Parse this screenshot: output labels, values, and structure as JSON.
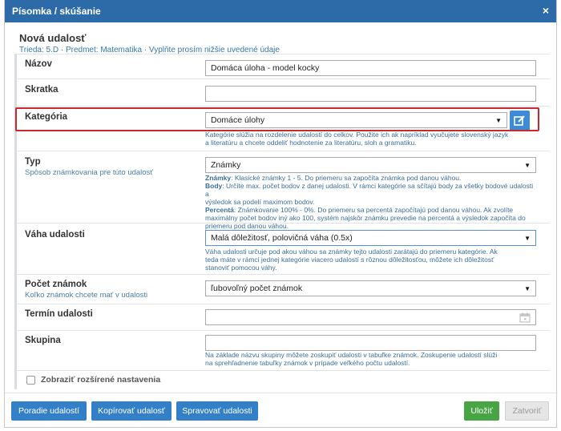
{
  "window": {
    "title": "Písomka / skúšanie",
    "close_icon": "×"
  },
  "heading": {
    "title": "Nová udalosť",
    "subtitle": "Trieda: 5.D · Predmet: Matematika · Vyplňte prosím nižšie uvedené údaje"
  },
  "fields": {
    "nazov": {
      "label": "Názov",
      "value": "Domáca úloha - model kocky"
    },
    "skratka": {
      "label": "Skratka",
      "value": ""
    },
    "kategoria": {
      "label": "Kategória",
      "value": "Domáce úlohy",
      "help_1": "Kategórie slúžia na rozdelenie udalostí do celkov. Použite ich ak napríklad vyučujete slovenský jazyk",
      "help_2": "a literatúru a chcete oddeliť hodnotenie za literatúru, sloh a gramatiku."
    },
    "typ": {
      "label": "Typ",
      "sublabel": "Spôsob známkovania pre túto udalosť",
      "value": "Známky",
      "help_znamky_label": "Známky",
      "help_znamky": ": Klasické známky 1 - 5. Do priemeru sa započíta známka pod danou váhou.",
      "help_body_label": "Body",
      "help_body_1": ": Určíte max. počet bodov z danej udalosti. V rámci kategórie sa sčítajú body za všetky bodové udalosti a",
      "help_body_2": "výsledok sa podelí maximom bodov.",
      "help_perc_label": "Percentá",
      "help_perc_1": ": Známkovanie 100% - 0%. Do priemeru sa percentá započítajú pod danou váhou. Ak zvolíte",
      "help_perc_2": "maximálny počet bodov iný ako 100, systém najskôr známku prevedie na percentá a výsledok započíta do",
      "help_perc_3": "priemeru pod danou váhou."
    },
    "vaha": {
      "label": "Váha udalosti",
      "value": "Malá dôležitosť, polovičná váha (0.5x)",
      "help_1": "Váha udalosti určuje pod akou váhou sa známky tejto udalosti zarátajú do priemeru kategórie. Ak",
      "help_2": "teda máte v rámci jednej kategórie viacero udalostí s rôznou dôležitosťou, môžete ich dôležitosť",
      "help_3": "stanoviť pomocou váhy."
    },
    "pocet": {
      "label": "Počet známok",
      "sublabel": "Koľko známok chcete mať v udalosti",
      "value": "ľubovoľný počet známok"
    },
    "termin": {
      "label": "Termín udalosti",
      "value": ""
    },
    "skupina": {
      "label": "Skupina",
      "value": "",
      "help_1": "Na základe názvu skupiny môžete zoskupiť udalosti v tabuľke známok. Zoskupenie udalostí slúži",
      "help_2": "na sprehľadnenie tabuľky známok v prípade veľkého počtu udalostí."
    }
  },
  "advanced": {
    "label": "Zobraziť rozšírené nastavenia",
    "checked": false
  },
  "footer": {
    "order_label": "Poradie udalostí",
    "copy_label": "Kopírovať udalosť",
    "manage_label": "Spravovať udalosti",
    "save_label": "Uložiť",
    "close_label": "Zatvoriť"
  },
  "colors": {
    "header": "#2d6ba8",
    "accent_blue": "#3480c8",
    "save_green": "#48a544",
    "highlight": "#c8282f"
  }
}
